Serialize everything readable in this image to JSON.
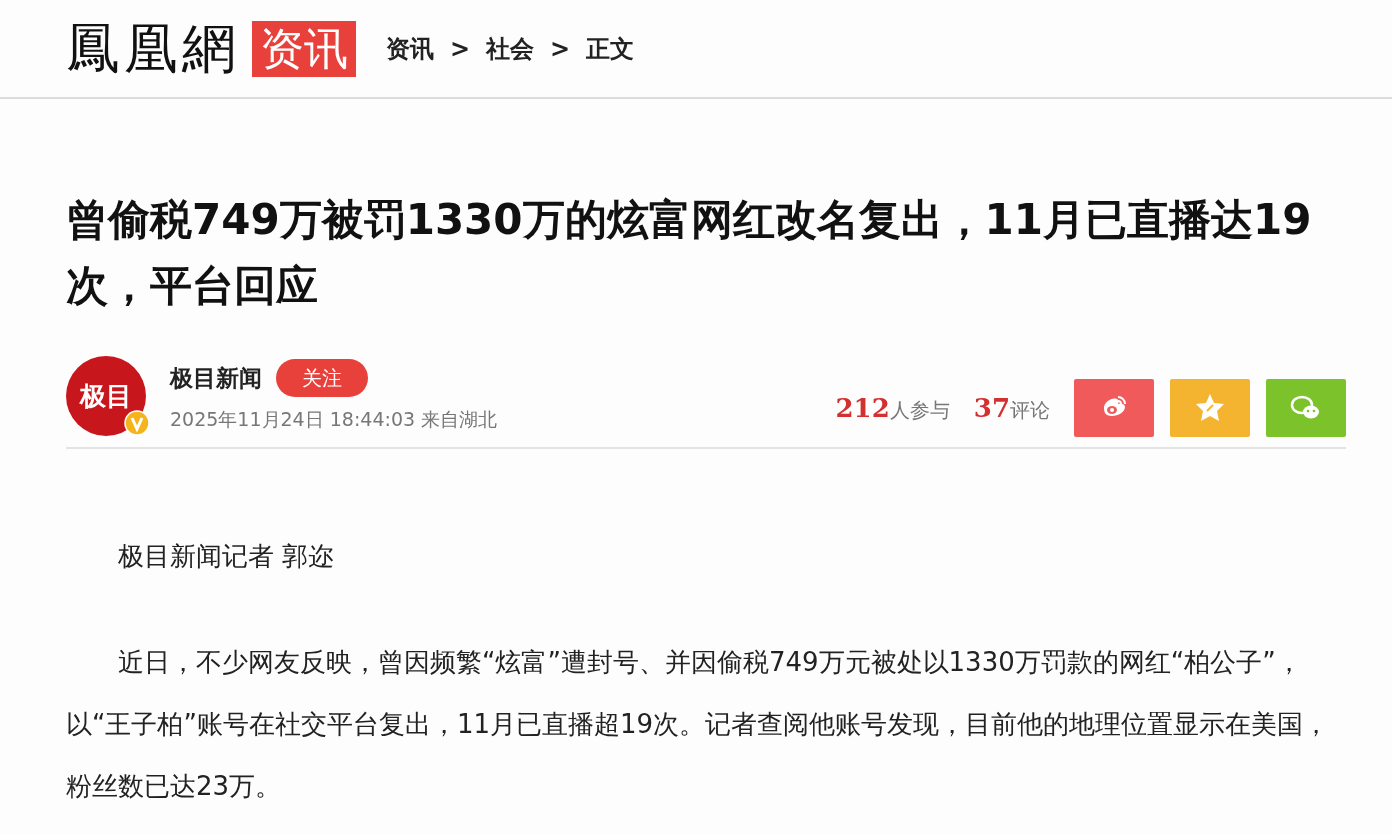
{
  "header": {
    "logo": "鳳凰網",
    "channel": "资讯",
    "breadcrumb": [
      "资讯",
      "社会",
      "正文"
    ],
    "separator": ">"
  },
  "article": {
    "title": "曾偷税749万被罚1330万的炫富网红改名复出，11月已直播达19次，平台回应",
    "author": {
      "avatar_text": "极目",
      "name": "极目新闻",
      "follow": "关注",
      "verified": true,
      "meta": "2025年11月24日 18:44:03 来自湖北"
    },
    "stats": [
      {
        "count": "212",
        "label": "人参与"
      },
      {
        "count": "37",
        "label": "评论"
      }
    ],
    "share": [
      {
        "kind": "weibo",
        "color": "#f05a5a"
      },
      {
        "kind": "qzone",
        "color": "#f5b430"
      },
      {
        "kind": "wechat",
        "color": "#7cc22a"
      }
    ],
    "paragraphs": [
      "极目新闻记者 郭迩",
      "近日，不少网友反映，曾因频繁“炫富”遭封号、并因偷税749万元被处以1330万罚款的网红“柏公子”，以“王子柏”账号在社交平台复出，11月已直播超19次。记者查阅他账号发现，目前他的地理位置显示在美国，粉丝数已达23万。"
    ]
  }
}
